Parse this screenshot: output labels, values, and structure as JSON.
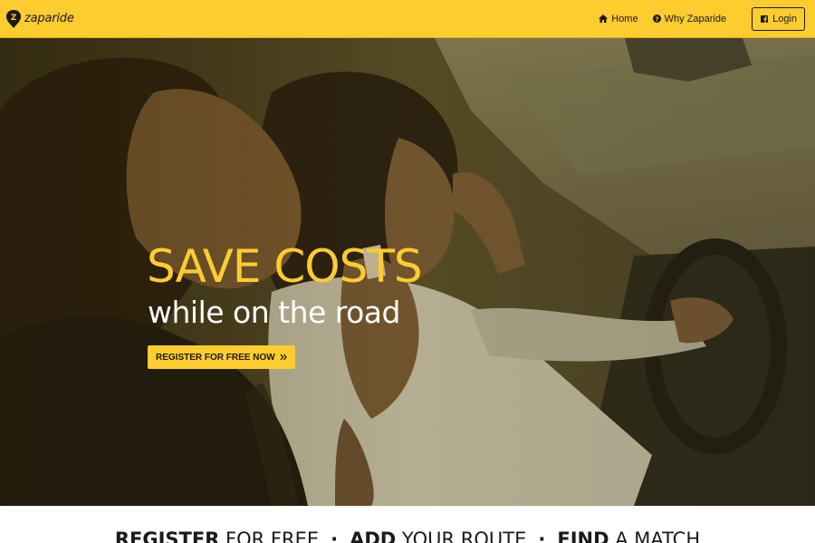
{
  "header": {
    "brand": "zaparide",
    "nav": [
      {
        "label": "Home",
        "icon": "home-icon"
      },
      {
        "label": "Why Zaparide",
        "icon": "question-circle-icon"
      }
    ],
    "login_label": "Login",
    "login_icon": "facebook-icon"
  },
  "hero": {
    "title": "SAVE COSTS",
    "subtitle": "while on the road",
    "cta_label": "REGISTER FOR FREE NOW",
    "cta_icon": "double-chevron-right-icon",
    "image": "photo of two women laughing in a car, one driving"
  },
  "steps": [
    {
      "strong": "REGISTER",
      "rest": " FOR FREE"
    },
    {
      "strong": "ADD",
      "rest": " YOUR ROUTE"
    },
    {
      "strong": "FIND",
      "rest": " A MATCH"
    }
  ],
  "step_separator": "·",
  "colors": {
    "accent": "#fdcc2f",
    "text_dark": "#1a1a1a",
    "white": "#ffffff"
  }
}
